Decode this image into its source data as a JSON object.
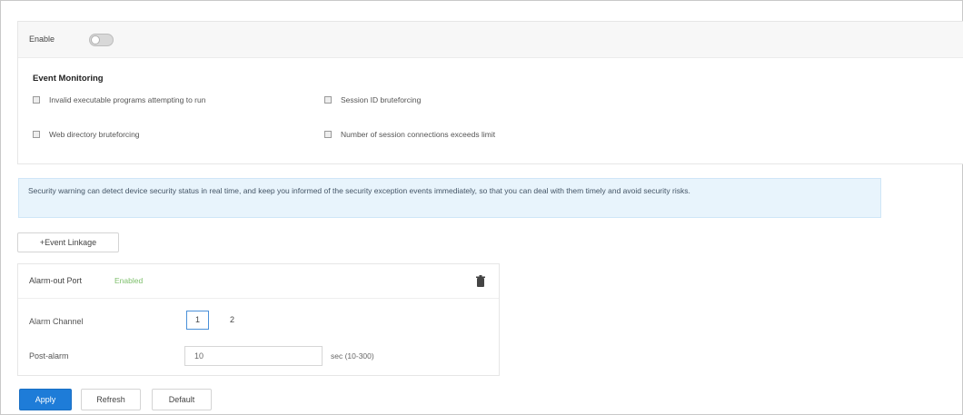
{
  "enable": {
    "label": "Enable",
    "state": "off"
  },
  "event_monitoring": {
    "title": "Event Monitoring",
    "items": [
      {
        "label": "Invalid executable programs attempting to run",
        "checked": true
      },
      {
        "label": "Session ID bruteforcing",
        "checked": true
      },
      {
        "label": "Web directory bruteforcing",
        "checked": true
      },
      {
        "label": "Number of session connections exceeds limit",
        "checked": true
      }
    ]
  },
  "info_message": "Security warning can detect device security status in real time, and keep you informed of the security exception events immediately, so that you can deal with them timely and avoid security risks.",
  "event_linkage_button": "+Event Linkage",
  "alarm_out": {
    "label": "Alarm-out Port",
    "status": "Enabled",
    "channel_label": "Alarm Channel",
    "channels": [
      "1",
      "2"
    ],
    "selected_channel": "1",
    "post_alarm_label": "Post-alarm",
    "post_alarm_value": "10",
    "post_alarm_unit": "sec (10-300)"
  },
  "footer": {
    "apply": "Apply",
    "refresh": "Refresh",
    "default": "Default"
  },
  "colors": {
    "accent": "#1e7cd8",
    "info_bg": "#e8f4fc",
    "enabled_text": "#7dbf6b"
  },
  "icons": {
    "delete": "trash-icon"
  }
}
